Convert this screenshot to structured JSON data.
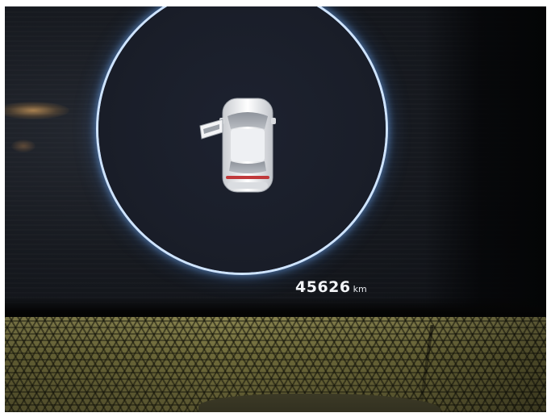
{
  "cluster": {
    "odometer_value": "45626",
    "odometer_unit": "km"
  },
  "door_status": {
    "open_door": "front-left"
  },
  "colors": {
    "ring_glow": "#cfe4ff",
    "screen_background": "#1a1e29",
    "fabric": "#6f6b3c"
  }
}
